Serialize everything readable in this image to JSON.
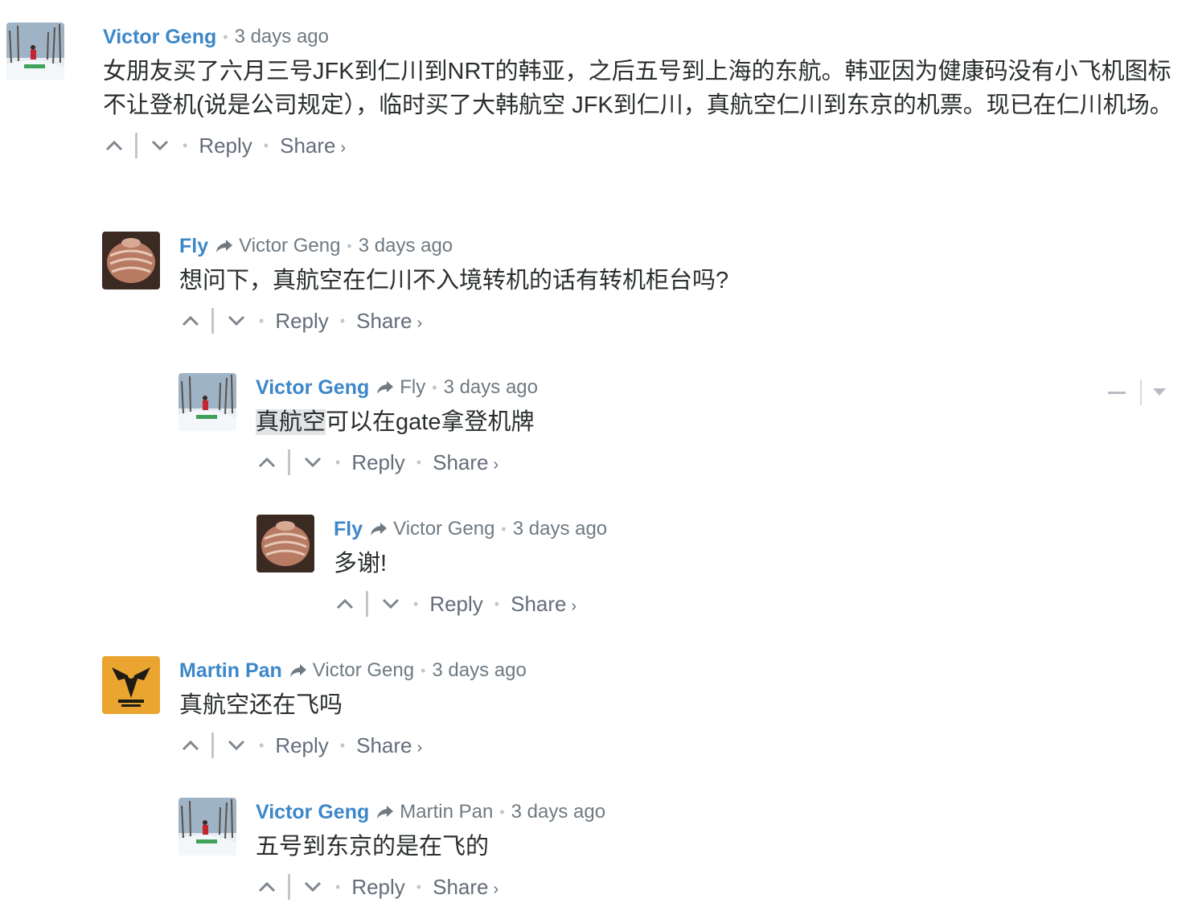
{
  "comments": [
    {
      "author": "Victor Geng",
      "reply_to": "",
      "time": "3 days ago",
      "text": "女朋友买了六月三号JFK到仁川到NRT的韩亚，之后五号到上海的东航。韩亚因为健康码没有小飞机图标不让登机(说是公司规定），临时买了大韩航空 JFK到仁川，真航空仁川到东京的机票。现已在仁川机场。",
      "reply_label": "Reply",
      "share_label": "Share"
    },
    {
      "author": "Fly",
      "reply_to": "Victor Geng",
      "time": "3 days ago",
      "text": "想问下，真航空在仁川不入境转机的话有转机柜台吗?",
      "reply_label": "Reply",
      "share_label": "Share"
    },
    {
      "author": "Victor Geng",
      "reply_to": "Fly",
      "time": "3 days ago",
      "text_highlight": "真航空",
      "text": "可以在gate拿登机牌",
      "reply_label": "Reply",
      "share_label": "Share"
    },
    {
      "author": "Fly",
      "reply_to": "Victor Geng",
      "time": "3 days ago",
      "text": "多谢!",
      "reply_label": "Reply",
      "share_label": "Share"
    },
    {
      "author": "Martin Pan",
      "reply_to": "Victor Geng",
      "time": "3 days ago",
      "text": "真航空还在飞吗",
      "reply_label": "Reply",
      "share_label": "Share"
    },
    {
      "author": "Victor Geng",
      "reply_to": "Martin Pan",
      "time": "3 days ago",
      "text": "五号到东京的是在飞的",
      "reply_label": "Reply",
      "share_label": "Share"
    }
  ],
  "icons": {
    "upvote": "chevron-up-icon",
    "downvote": "chevron-down-icon",
    "reply_arrow": "reply-arrow-icon",
    "share_chevron": "chevron-right-icon",
    "collapse": "minus-icon",
    "menu": "caret-down-icon"
  },
  "share_chevron_glyph": "›",
  "dot_glyph": "•",
  "colors": {
    "author": "#3d87c9",
    "meta": "#6f7a82",
    "text": "#2a2e2e",
    "highlight": "#e2e4e6"
  }
}
